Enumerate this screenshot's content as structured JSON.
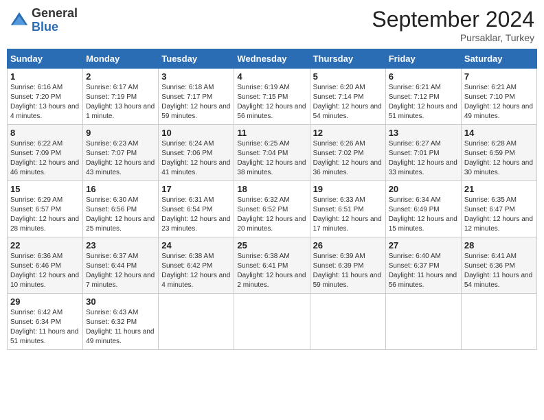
{
  "header": {
    "logo_line1": "General",
    "logo_line2": "Blue",
    "month_year": "September 2024",
    "location": "Pursaklar, Turkey"
  },
  "days_of_week": [
    "Sunday",
    "Monday",
    "Tuesday",
    "Wednesday",
    "Thursday",
    "Friday",
    "Saturday"
  ],
  "weeks": [
    [
      {
        "day": "1",
        "sunrise": "Sunrise: 6:16 AM",
        "sunset": "Sunset: 7:20 PM",
        "daylight": "Daylight: 13 hours and 4 minutes."
      },
      {
        "day": "2",
        "sunrise": "Sunrise: 6:17 AM",
        "sunset": "Sunset: 7:19 PM",
        "daylight": "Daylight: 13 hours and 1 minute."
      },
      {
        "day": "3",
        "sunrise": "Sunrise: 6:18 AM",
        "sunset": "Sunset: 7:17 PM",
        "daylight": "Daylight: 12 hours and 59 minutes."
      },
      {
        "day": "4",
        "sunrise": "Sunrise: 6:19 AM",
        "sunset": "Sunset: 7:15 PM",
        "daylight": "Daylight: 12 hours and 56 minutes."
      },
      {
        "day": "5",
        "sunrise": "Sunrise: 6:20 AM",
        "sunset": "Sunset: 7:14 PM",
        "daylight": "Daylight: 12 hours and 54 minutes."
      },
      {
        "day": "6",
        "sunrise": "Sunrise: 6:21 AM",
        "sunset": "Sunset: 7:12 PM",
        "daylight": "Daylight: 12 hours and 51 minutes."
      },
      {
        "day": "7",
        "sunrise": "Sunrise: 6:21 AM",
        "sunset": "Sunset: 7:10 PM",
        "daylight": "Daylight: 12 hours and 49 minutes."
      }
    ],
    [
      {
        "day": "8",
        "sunrise": "Sunrise: 6:22 AM",
        "sunset": "Sunset: 7:09 PM",
        "daylight": "Daylight: 12 hours and 46 minutes."
      },
      {
        "day": "9",
        "sunrise": "Sunrise: 6:23 AM",
        "sunset": "Sunset: 7:07 PM",
        "daylight": "Daylight: 12 hours and 43 minutes."
      },
      {
        "day": "10",
        "sunrise": "Sunrise: 6:24 AM",
        "sunset": "Sunset: 7:06 PM",
        "daylight": "Daylight: 12 hours and 41 minutes."
      },
      {
        "day": "11",
        "sunrise": "Sunrise: 6:25 AM",
        "sunset": "Sunset: 7:04 PM",
        "daylight": "Daylight: 12 hours and 38 minutes."
      },
      {
        "day": "12",
        "sunrise": "Sunrise: 6:26 AM",
        "sunset": "Sunset: 7:02 PM",
        "daylight": "Daylight: 12 hours and 36 minutes."
      },
      {
        "day": "13",
        "sunrise": "Sunrise: 6:27 AM",
        "sunset": "Sunset: 7:01 PM",
        "daylight": "Daylight: 12 hours and 33 minutes."
      },
      {
        "day": "14",
        "sunrise": "Sunrise: 6:28 AM",
        "sunset": "Sunset: 6:59 PM",
        "daylight": "Daylight: 12 hours and 30 minutes."
      }
    ],
    [
      {
        "day": "15",
        "sunrise": "Sunrise: 6:29 AM",
        "sunset": "Sunset: 6:57 PM",
        "daylight": "Daylight: 12 hours and 28 minutes."
      },
      {
        "day": "16",
        "sunrise": "Sunrise: 6:30 AM",
        "sunset": "Sunset: 6:56 PM",
        "daylight": "Daylight: 12 hours and 25 minutes."
      },
      {
        "day": "17",
        "sunrise": "Sunrise: 6:31 AM",
        "sunset": "Sunset: 6:54 PM",
        "daylight": "Daylight: 12 hours and 23 minutes."
      },
      {
        "day": "18",
        "sunrise": "Sunrise: 6:32 AM",
        "sunset": "Sunset: 6:52 PM",
        "daylight": "Daylight: 12 hours and 20 minutes."
      },
      {
        "day": "19",
        "sunrise": "Sunrise: 6:33 AM",
        "sunset": "Sunset: 6:51 PM",
        "daylight": "Daylight: 12 hours and 17 minutes."
      },
      {
        "day": "20",
        "sunrise": "Sunrise: 6:34 AM",
        "sunset": "Sunset: 6:49 PM",
        "daylight": "Daylight: 12 hours and 15 minutes."
      },
      {
        "day": "21",
        "sunrise": "Sunrise: 6:35 AM",
        "sunset": "Sunset: 6:47 PM",
        "daylight": "Daylight: 12 hours and 12 minutes."
      }
    ],
    [
      {
        "day": "22",
        "sunrise": "Sunrise: 6:36 AM",
        "sunset": "Sunset: 6:46 PM",
        "daylight": "Daylight: 12 hours and 10 minutes."
      },
      {
        "day": "23",
        "sunrise": "Sunrise: 6:37 AM",
        "sunset": "Sunset: 6:44 PM",
        "daylight": "Daylight: 12 hours and 7 minutes."
      },
      {
        "day": "24",
        "sunrise": "Sunrise: 6:38 AM",
        "sunset": "Sunset: 6:42 PM",
        "daylight": "Daylight: 12 hours and 4 minutes."
      },
      {
        "day": "25",
        "sunrise": "Sunrise: 6:38 AM",
        "sunset": "Sunset: 6:41 PM",
        "daylight": "Daylight: 12 hours and 2 minutes."
      },
      {
        "day": "26",
        "sunrise": "Sunrise: 6:39 AM",
        "sunset": "Sunset: 6:39 PM",
        "daylight": "Daylight: 11 hours and 59 minutes."
      },
      {
        "day": "27",
        "sunrise": "Sunrise: 6:40 AM",
        "sunset": "Sunset: 6:37 PM",
        "daylight": "Daylight: 11 hours and 56 minutes."
      },
      {
        "day": "28",
        "sunrise": "Sunrise: 6:41 AM",
        "sunset": "Sunset: 6:36 PM",
        "daylight": "Daylight: 11 hours and 54 minutes."
      }
    ],
    [
      {
        "day": "29",
        "sunrise": "Sunrise: 6:42 AM",
        "sunset": "Sunset: 6:34 PM",
        "daylight": "Daylight: 11 hours and 51 minutes."
      },
      {
        "day": "30",
        "sunrise": "Sunrise: 6:43 AM",
        "sunset": "Sunset: 6:32 PM",
        "daylight": "Daylight: 11 hours and 49 minutes."
      },
      null,
      null,
      null,
      null,
      null
    ]
  ]
}
